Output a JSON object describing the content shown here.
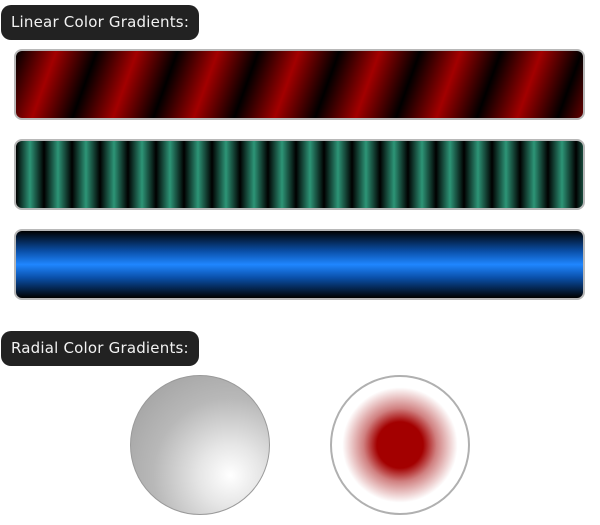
{
  "labels": {
    "linear": "Linear Color Gradients:",
    "radial": "Radial Color Gradients:"
  },
  "linear_gradients": [
    {
      "name": "red-black diagonal stripes",
      "colors": [
        "#000000",
        "#a30000"
      ]
    },
    {
      "name": "teal-black vertical stripes",
      "colors": [
        "#000000",
        "#2d9577"
      ]
    },
    {
      "name": "blue horizontal band",
      "colors": [
        "#000000",
        "#1f86ff"
      ]
    }
  ],
  "radial_gradients": [
    {
      "name": "gray sphere",
      "colors": [
        "#ffffff",
        "#9a9a9a"
      ]
    },
    {
      "name": "red center dot",
      "colors": [
        "#a30000",
        "#ffffff"
      ]
    }
  ]
}
